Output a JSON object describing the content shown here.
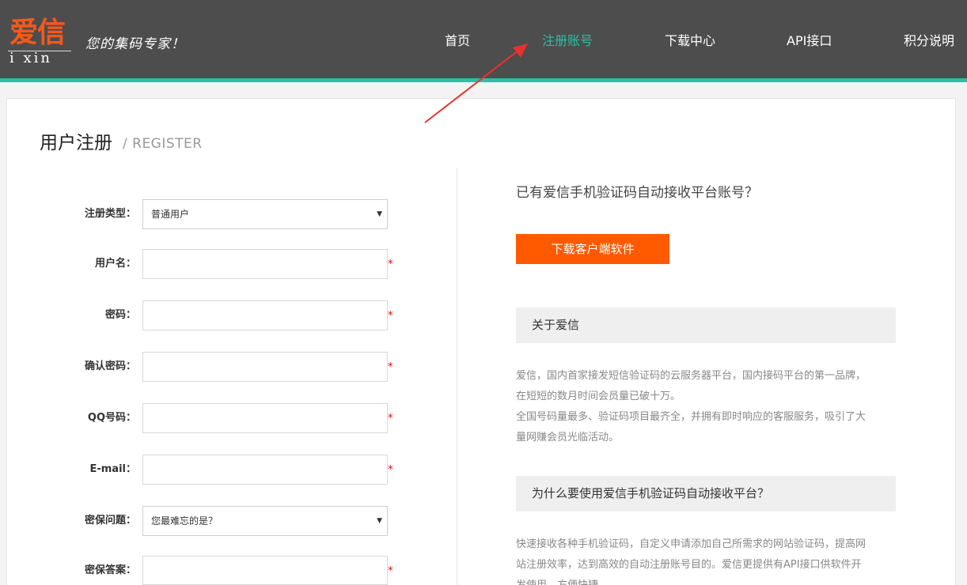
{
  "header": {
    "logo_text": "爱信",
    "logo_sub": "i xin",
    "slogan": "您的集码专家！",
    "nav": [
      {
        "label": "首页",
        "active": false
      },
      {
        "label": "注册账号",
        "active": true
      },
      {
        "label": "下载中心",
        "active": false
      },
      {
        "label": "API接口",
        "active": false
      },
      {
        "label": "积分说明",
        "active": false
      }
    ]
  },
  "page": {
    "title": "用户注册",
    "subtitle": "/ REGISTER"
  },
  "form": {
    "fields": [
      {
        "label": "注册类型：",
        "type": "select",
        "value": "普通用户",
        "required": false
      },
      {
        "label": "用户名：",
        "type": "text",
        "value": "",
        "required": true
      },
      {
        "label": "密码：",
        "type": "password",
        "value": "",
        "required": true
      },
      {
        "label": "确认密码：",
        "type": "password",
        "value": "",
        "required": true
      },
      {
        "label": "QQ号码：",
        "type": "text",
        "value": "",
        "required": true
      },
      {
        "label": "E-mail：",
        "type": "text",
        "value": "",
        "required": true
      },
      {
        "label": "密保问题：",
        "type": "select",
        "value": "您最难忘的是？",
        "required": false
      },
      {
        "label": "密保答案：",
        "type": "text",
        "value": "",
        "required": true
      }
    ],
    "required_mark": "*"
  },
  "aside": {
    "have_account": "已有爱信手机验证码自动接收平台账号？",
    "download_button": "下载客户端软件",
    "about_title": "关于爱信",
    "about_lines": [
      "爱信，国内首家接发短信验证码的云服务器平台，国内接码平台的第一品牌，",
      "在短短的数月时间会员量已破十万。",
      "全国号码量最多、验证码项目最齐全，并拥有即时响应的客服服务，吸引了大",
      "量网赚会员光临活动。"
    ],
    "why_title": "为什么要使用爱信手机验证码自动接收平台？",
    "why_lines": [
      "快速接收各种手机验证码，自定义申请添加自己所需求的网站验证码，提高网",
      "站注册效率，达到高效的自动注册账号目的。爱信更提供有API接口供软件开",
      "发使用，方便快捷。"
    ]
  },
  "colors": {
    "header_bg": "#4d4d4d",
    "accent_teal": "#2bbfa6",
    "brand_orange": "#ff5a00",
    "required_red": "#ee0000"
  }
}
